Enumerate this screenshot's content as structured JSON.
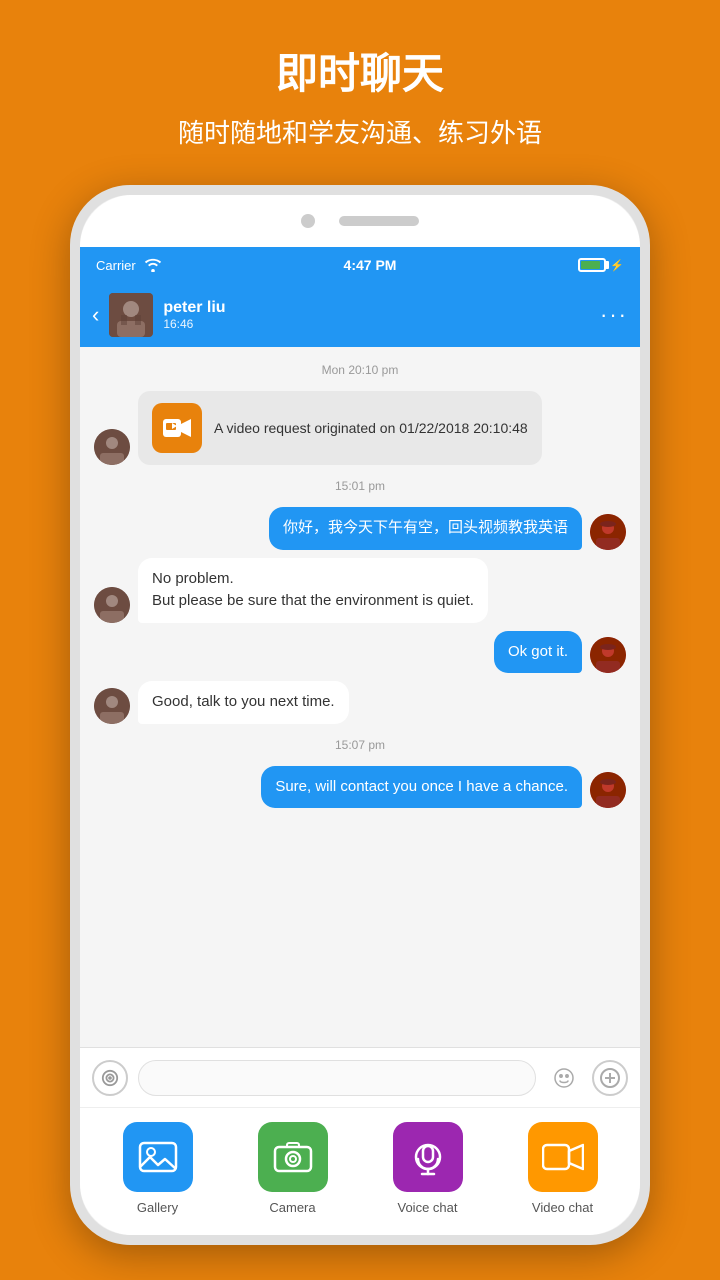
{
  "page": {
    "background_color": "#E8820C",
    "title": "即时聊天",
    "subtitle": "随时随地和学友沟通、练习外语"
  },
  "status_bar": {
    "carrier": "Carrier",
    "time": "4:47 PM",
    "signal": "wifi"
  },
  "chat_header": {
    "back_label": "‹",
    "contact_name": "peter liu",
    "contact_status": "16:46",
    "more_label": "···"
  },
  "messages": [
    {
      "type": "time",
      "text": "Mon 20:10 pm"
    },
    {
      "type": "video_request",
      "side": "incoming",
      "text": "A video request originated on 01/22/2018 20:10:48"
    },
    {
      "type": "time",
      "text": "15:01 pm"
    },
    {
      "type": "bubble",
      "side": "outgoing",
      "text": "你好，我今天下午有空，回头视频教我英语"
    },
    {
      "type": "bubble",
      "side": "incoming",
      "text": "No  problem.\nBut  please be sure that the environment is  quiet."
    },
    {
      "type": "bubble",
      "side": "outgoing",
      "text": "Ok got it."
    },
    {
      "type": "bubble",
      "side": "incoming",
      "text": "Good, talk  to you next time."
    },
    {
      "type": "time",
      "text": "15:07 pm"
    },
    {
      "type": "bubble",
      "side": "outgoing",
      "text": "Sure, will contact you once I have a chance."
    }
  ],
  "input_bar": {
    "placeholder": "",
    "voice_icon": "◎",
    "emoji_icon": "☺",
    "add_icon": "+"
  },
  "bottom_toolbar": {
    "items": [
      {
        "id": "gallery",
        "label": "Gallery",
        "color": "#2196F3"
      },
      {
        "id": "camera",
        "label": "Camera",
        "color": "#4CAF50"
      },
      {
        "id": "voice_chat",
        "label": "Voice chat",
        "color": "#9C27B0"
      },
      {
        "id": "video_chat",
        "label": "Video chat",
        "color": "#FF9800"
      }
    ]
  }
}
